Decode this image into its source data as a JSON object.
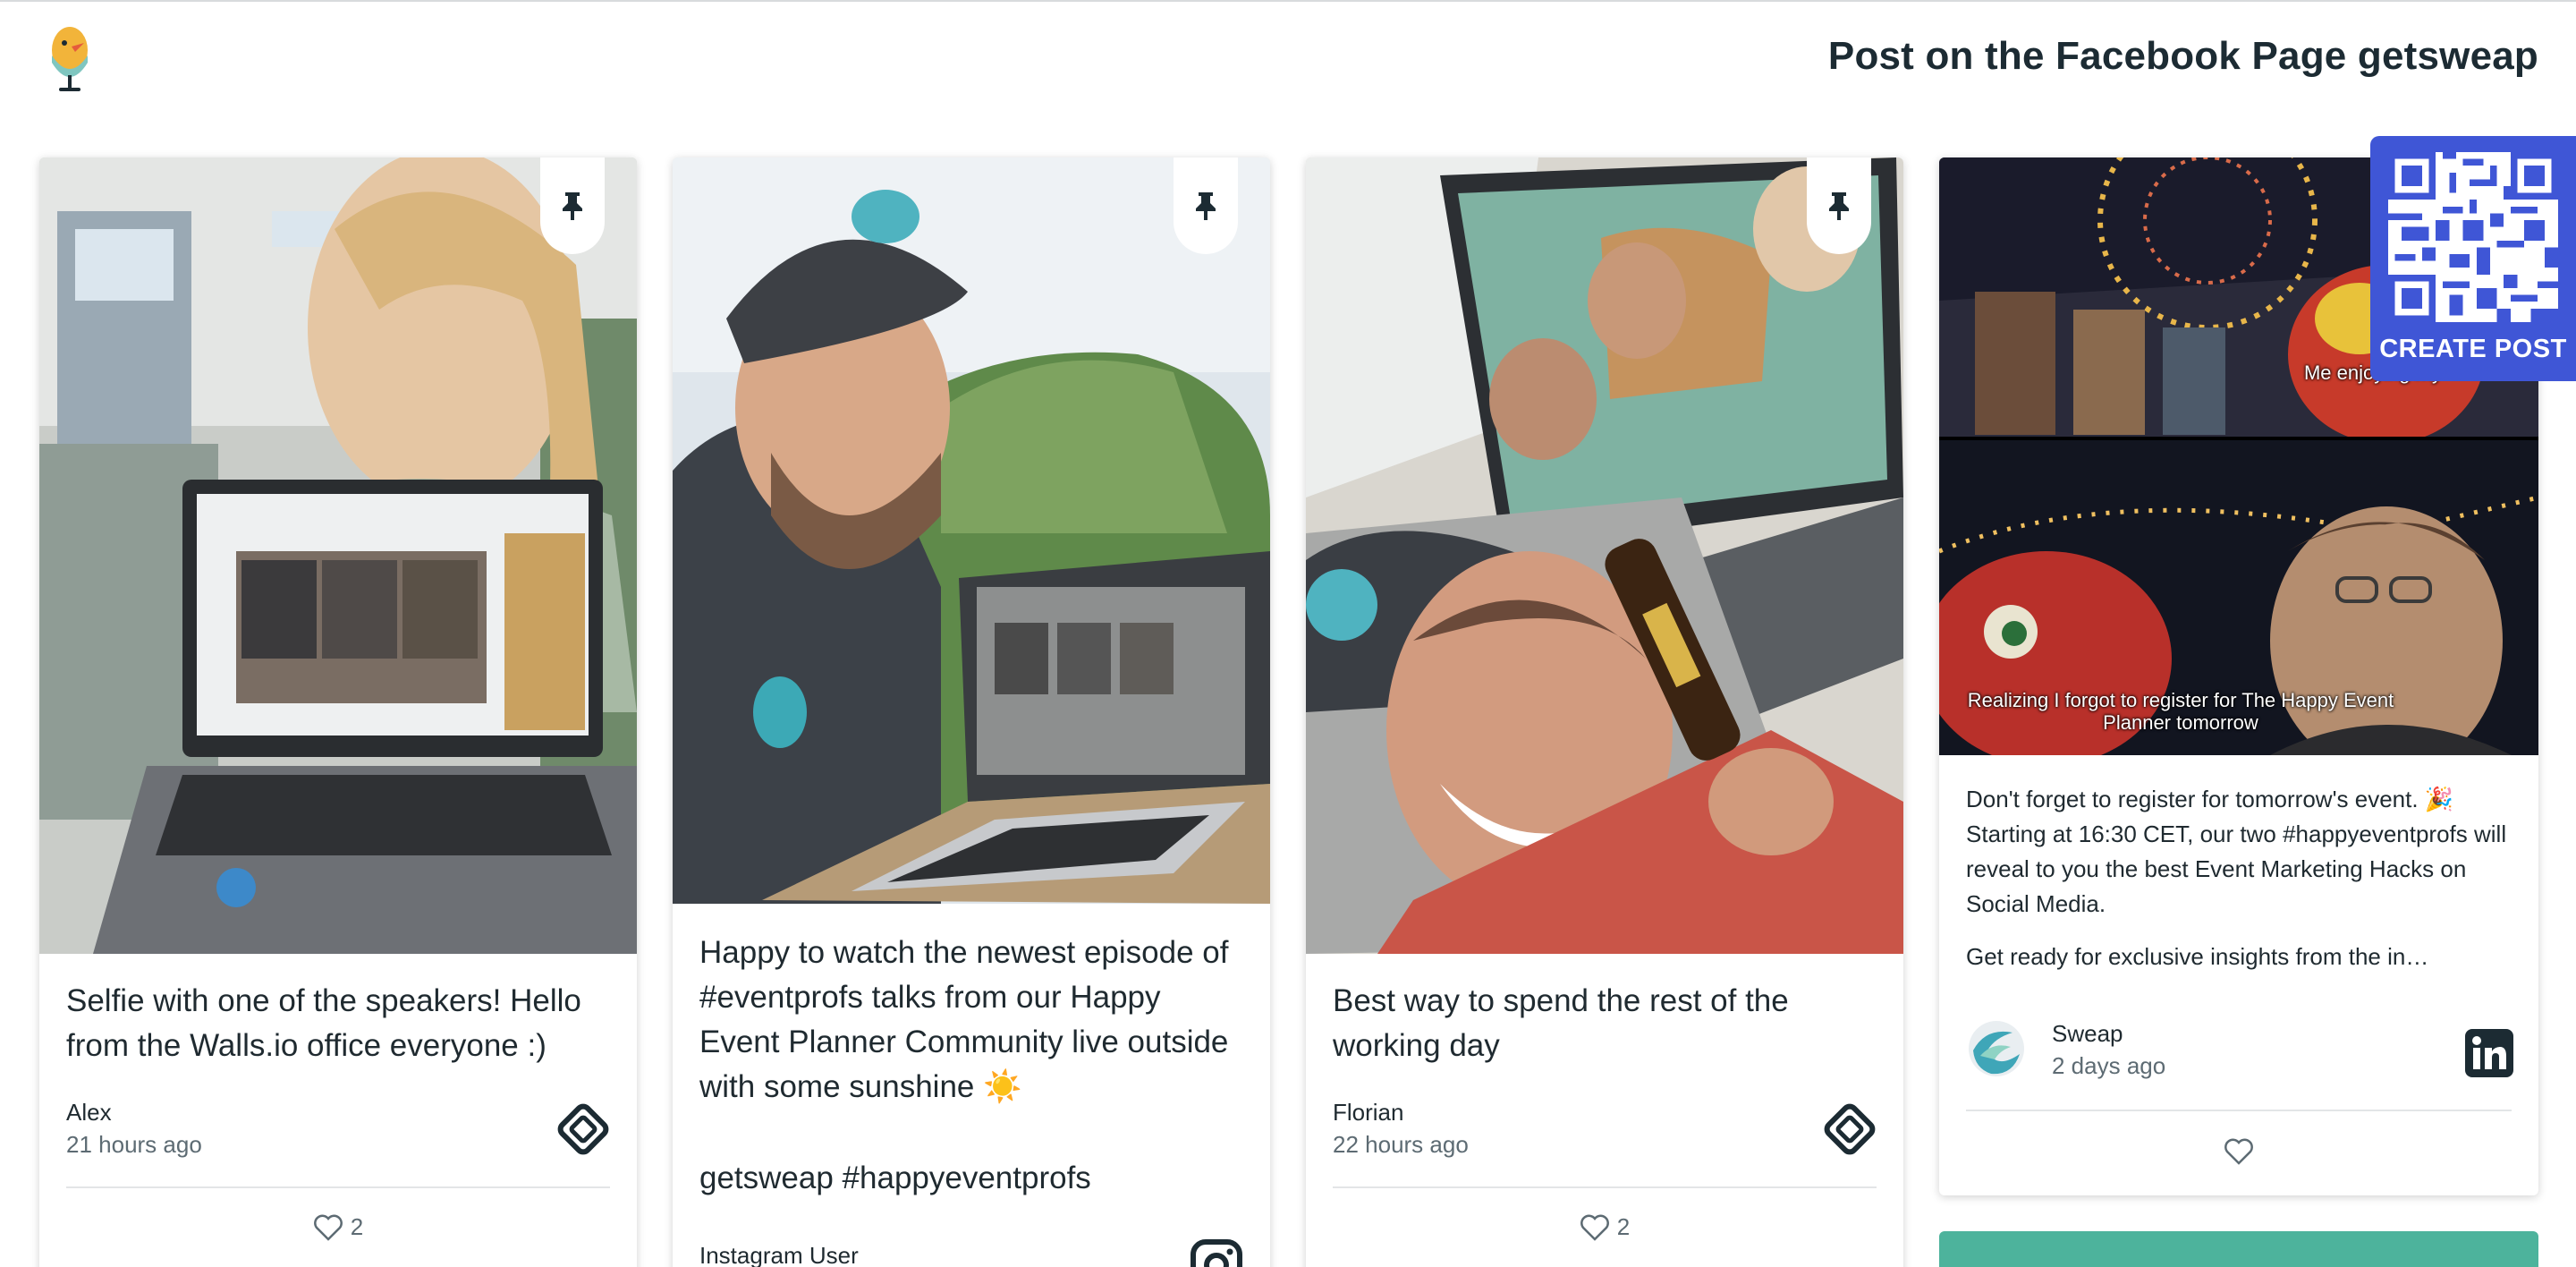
{
  "header": {
    "page_title": "Post on the Facebook Page getsweap"
  },
  "create_post": {
    "label": "CREATE POST"
  },
  "posts": [
    {
      "caption": "Selfie with one of the speakers! Hello from the Walls.io office everyone :)",
      "author": "Alex",
      "time": "21 hours ago",
      "likes": "2",
      "source_icon": "walls-io-icon",
      "pinned": true
    },
    {
      "caption": "Happy to watch the newest episode of #eventprofs talks from our Happy Event Planner Community live outside with some sunshine ☀️",
      "hashtags": "getsweap #happyeventprofs",
      "author": "Instagram User",
      "source_icon": "instagram-icon",
      "pinned": true
    },
    {
      "caption": "Best way to spend the rest of the working day",
      "author": "Florian",
      "time": "22 hours ago",
      "likes": "2",
      "source_icon": "walls-io-icon",
      "pinned": true
    },
    {
      "meme_top": "Me enjoying my",
      "meme_bottom": "Realizing I forgot to register for The Happy Event Planner tomorrow",
      "body_line1": "Don't forget to register for tomorrow's event. 🎉 Starting at 16:30 CET, our two #happyeventprofs will reveal to you the best Event Marketing Hacks on Social Media.",
      "body_line2": "Get ready for exclusive insights from the in…",
      "author": "Sweap",
      "time": "2 days ago",
      "source_icon": "linkedin-icon"
    }
  ],
  "colors": {
    "accent_blue": "#3f56d6",
    "teal": "#4db39c",
    "title": "#1c2b33"
  }
}
